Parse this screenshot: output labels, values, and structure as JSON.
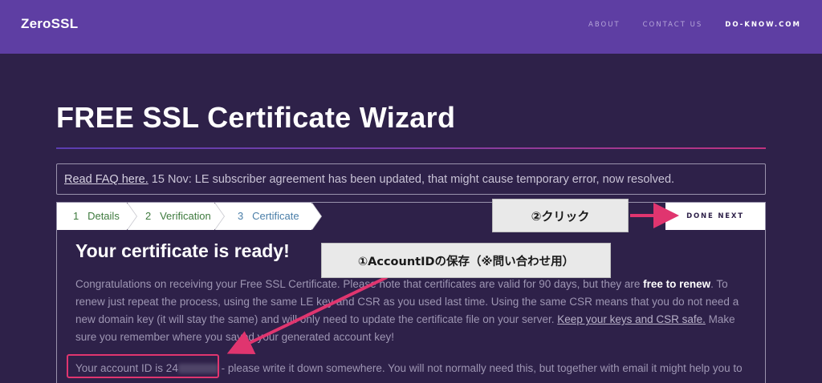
{
  "header": {
    "brand": "ZeroSSL",
    "nav": [
      "ABOUT",
      "CONTACT US",
      "DO-KNOW.COM"
    ]
  },
  "page": {
    "title": "FREE SSL Certificate Wizard"
  },
  "notice": {
    "faq_link": "Read FAQ here.",
    "text": " 15 Nov: LE subscriber agreement has been updated, that might cause temporary error, now resolved."
  },
  "steps": [
    {
      "num": "1",
      "label": "Details"
    },
    {
      "num": "2",
      "label": "Verification"
    },
    {
      "num": "3",
      "label": "Certificate"
    }
  ],
  "done_next": "DONE NEXT",
  "callouts": {
    "click": "②クリック",
    "save": "①AccountIDの保存（※問い合わせ用）"
  },
  "certificate": {
    "heading": "Your certificate is ready!",
    "p1_a": "Congratulations on receiving your Free SSL Certificate. Please note that certificates are valid for 90 days, but they are ",
    "p1_bold": "free to renew",
    "p1_b": ". To renew just repeat the process, using the same LE key and CSR as you used last time. Using the same CSR means that you do not need a new domain key (it will stay the same) and will only need to update the certificate file on your server. ",
    "p1_link": "Keep your keys and CSR safe.",
    "p1_c": " Make sure you remember where you saved your generated account key!",
    "account_prefix": "Your account ID is 24",
    "account_suffix": " - please write it down somewhere. You will not normally need this, but together with email it might help you to"
  },
  "colors": {
    "topbar": "#5e3ea3",
    "background": "#2e2149",
    "annotation": "#e0356f"
  }
}
